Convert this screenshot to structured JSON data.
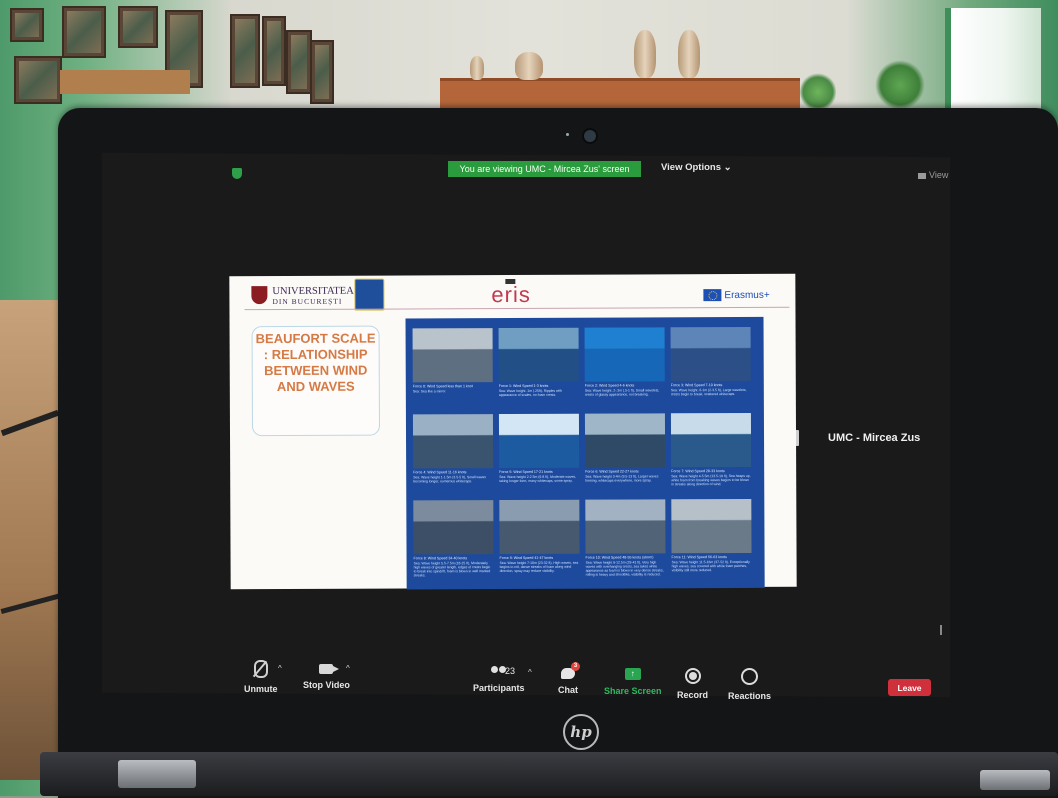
{
  "meeting": {
    "share_banner": "You are viewing UMC - Mircea Zus' screen",
    "view_options": "View Options",
    "view_button": "View",
    "participant_name": "UMC - Mircea Zus",
    "brand": "hp"
  },
  "slide": {
    "university_line1": "UNIVERSITATEA",
    "university_line2": "DIN BUCUREȘTI",
    "project_logo": "eris",
    "erasmus": "Erasmus+",
    "title": "BEAUFORT SCALE : RELATIONSHIP BETWEEN WIND AND WAVES",
    "tiles": [
      {
        "caption": "Force 0: Wind Speed less than 1 knot",
        "detail": "Sea: Sea like a mirror.",
        "sky": "#b8c3cc",
        "sea": "#5d6f80"
      },
      {
        "caption": "Force 1: Wind Speed 1-3 knots",
        "detail": "Sea: Wave height .1m (.25ft), Ripples with appearance of scales, no foam crests.",
        "sky": "#6f9ec2",
        "sea": "#214f86"
      },
      {
        "caption": "Force 2: Wind Speed 4-6 knots",
        "detail": "Sea: Wave height .2-.3m (.5-1 ft), Small wavelets, crests of glassy appearance, not breaking.",
        "sky": "#1f7fd0",
        "sea": "#1667b8"
      },
      {
        "caption": "Force 3: Wind Speed 7-10 knots",
        "detail": "Sea: Wave height .6-1m (2-3.5 ft), Large wavelets, crests begin to break, scattered whitecaps.",
        "sky": "#5d85b8",
        "sea": "#2b4f86"
      },
      {
        "caption": "Force 4: Wind Speed 11-16 knots",
        "detail": "Sea: Wave height 1-1.5m (3.5-5 ft), Small waves becoming longer, numerous whitecaps.",
        "sky": "#9ab0c4",
        "sea": "#3a5470"
      },
      {
        "caption": "Force 5: Wind Speed 17-21 knots",
        "detail": "Sea: Wave height 2-2.5m (6-8 ft), Moderate waves, taking longer form, many whitecaps, some spray.",
        "sky": "#d2e6f5",
        "sea": "#1c5ba0"
      },
      {
        "caption": "Force 6: Wind Speed 22-27 knots",
        "detail": "Sea: Wave height 3-4m (9.5-13 ft), Larger waves forming, whitecaps everywhere, more spray.",
        "sky": "#9fb6c8",
        "sea": "#2f4a66"
      },
      {
        "caption": "Force 7: Wind Speed 28-33 knots",
        "detail": "Sea: Wave height 4-5.5m (13.5-19 ft), Sea heaps up, white foam from breaking waves begins to be blown in streaks along direction of wind.",
        "sky": "#c7dbeb",
        "sea": "#2a5a8c"
      },
      {
        "caption": "Force 8: Wind Speed 34-40 knots",
        "detail": "Sea: Wave height 5.5-7.5m (18-25 ft), Moderately high waves of greater length, edges of crests begin to break into spindrift, foam is blown in well marked streaks.",
        "sky": "#7c8c9e",
        "sea": "#3d4f66"
      },
      {
        "caption": "Force 9: Wind Speed 41-47 knots",
        "detail": "Sea: Wave height 7-10m (23-32 ft), High waves, sea begins to roll, dense streaks of foam along wind direction, spray may reduce visibility.",
        "sky": "#8a9db0",
        "sea": "#46596e"
      },
      {
        "caption": "Force 10: Wind Speed 48-55 knots (storm)",
        "detail": "Sea: Wave height 9-12.5m (29-41 ft), Very high waves with overhanging crests, sea takes white appearance as foam is blown in very dense streaks, rolling is heavy and shocklike, visibility is reduced.",
        "sky": "#a2b2c2",
        "sea": "#506377"
      },
      {
        "caption": "Force 11: Wind Speed 56-63 knots",
        "detail": "Sea: Wave height 11.5-16m (37-52 ft), Exceptionally high waves, sea covered with white foam patches, visibility still more reduced.",
        "sky": "#b5c0c9",
        "sea": "#6a7a88"
      }
    ]
  },
  "toolbar": {
    "unmute": "Unmute",
    "stop_video": "Stop Video",
    "participants": "Participants",
    "participants_count": "23",
    "chat": "Chat",
    "chat_badge": "3",
    "share_screen": "Share Screen",
    "record": "Record",
    "reactions": "Reactions",
    "leave": "Leave",
    "share_color": "#2fb860",
    "leave_color": "#d0303c"
  }
}
